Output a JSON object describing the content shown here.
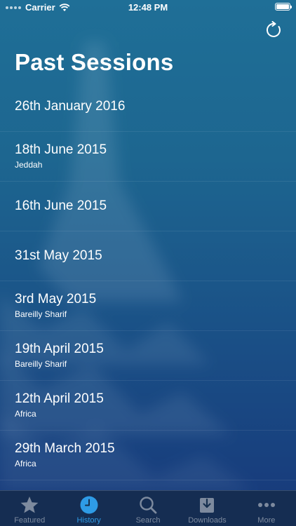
{
  "status_bar": {
    "carrier": "Carrier",
    "time": "12:48 PM"
  },
  "header": {
    "title": "Past Sessions",
    "refresh_icon": "refresh-icon"
  },
  "sessions": [
    {
      "date": "26th January 2016",
      "location": ""
    },
    {
      "date": "18th June 2015",
      "location": "Jeddah"
    },
    {
      "date": "16th June 2015",
      "location": ""
    },
    {
      "date": "31st May 2015",
      "location": ""
    },
    {
      "date": "3rd May 2015",
      "location": "Bareilly Sharif"
    },
    {
      "date": "19th April 2015",
      "location": "Bareilly Sharif"
    },
    {
      "date": "12th April 2015",
      "location": "Africa"
    },
    {
      "date": "29th March 2015",
      "location": "Africa"
    }
  ],
  "tab_bar": {
    "tabs": [
      {
        "label": "Featured",
        "icon": "star-icon",
        "active": false
      },
      {
        "label": "History",
        "icon": "clock-icon",
        "active": true
      },
      {
        "label": "Search",
        "icon": "search-icon",
        "active": false
      },
      {
        "label": "Downloads",
        "icon": "download-icon",
        "active": false
      },
      {
        "label": "More",
        "icon": "more-icon",
        "active": false
      }
    ]
  },
  "colors": {
    "accent": "#2e9be6",
    "inactive_tab": "#7d8a9e",
    "background_top": "#1f6f97",
    "background_bottom": "#17387a"
  }
}
